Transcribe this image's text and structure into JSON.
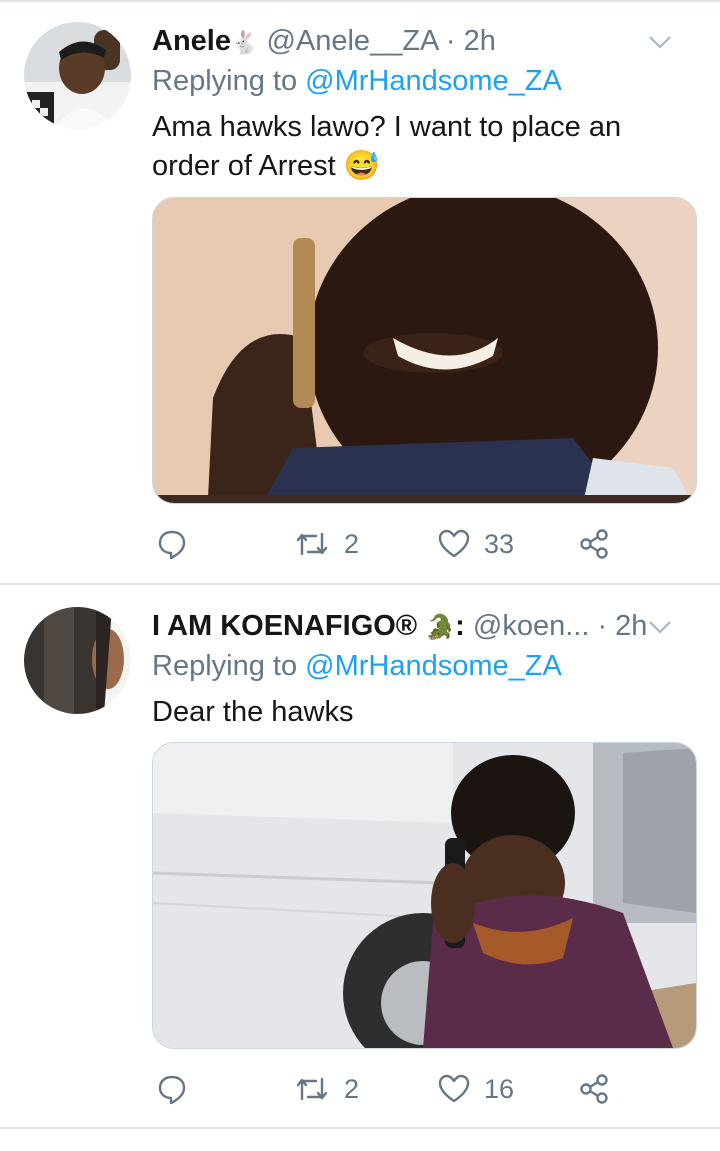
{
  "tweets": [
    {
      "display_name": "Anele",
      "name_emoji": "🐇",
      "handle": "@Anele__ZA",
      "dot": "·",
      "time": "2h",
      "replying_prefix": "Replying to ",
      "replying_to": "@MrHandsome_ZA",
      "text": "Ama hawks lawo? I want to place an order of Arrest 😅",
      "reply_count": "",
      "retweet_count": "2",
      "like_count": "33"
    },
    {
      "display_name": "I AM KOENAFIGO®",
      "name_emoji": "🐊",
      "name_suffix": ":",
      "handle": "@koen...",
      "dot": "·",
      "time": "2h",
      "replying_prefix": "Replying to ",
      "replying_to": "@MrHandsome_ZA",
      "text": "Dear the hawks",
      "reply_count": "",
      "retweet_count": "2",
      "like_count": "16"
    }
  ],
  "icons": {
    "reply": "reply-icon",
    "retweet": "retweet-icon",
    "like": "heart-icon",
    "share": "share-icon",
    "caret": "chevron-down-icon"
  },
  "colors": {
    "mention": "#1da1f2",
    "secondary_text": "#657786",
    "divider": "#e1e8ed"
  }
}
